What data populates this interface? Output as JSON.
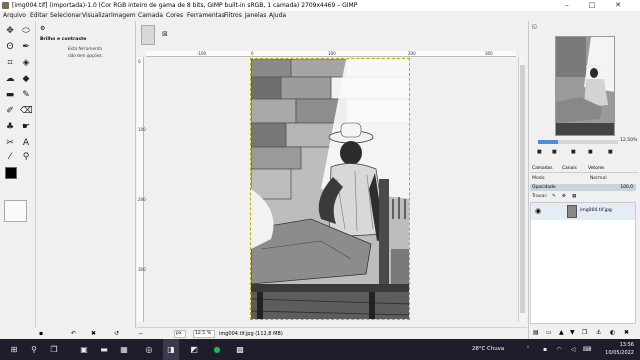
{
  "window": {
    "title": "[img004.tif] (importada)-1.0 (Cor RGB inteiro de gama de 8 bits, GIMP built-in sRGB, 1 camada) 2709x4469 – GIMP"
  },
  "menu": [
    "Arquivo",
    "Editar",
    "Selecionar",
    "Visualizar",
    "Imagem",
    "Camada",
    "Cores",
    "Ferramentas",
    "Filtros",
    "Janelas",
    "Ajuda"
  ],
  "tool_options": {
    "title": "Brilho e contraste",
    "message_line1": "Esta ferramenta",
    "message_line2": "não tem opções."
  },
  "rulers": {
    "h_labels": [
      "-100",
      "0",
      "100",
      "200",
      "300"
    ],
    "v_labels": [
      "0",
      "100",
      "200",
      "300"
    ]
  },
  "status": {
    "unit": "px",
    "zoom": "12,5 %",
    "info": "img004.tif.jpg (112,8 MB)"
  },
  "navigation": {
    "zoom_value": "12,50%",
    "zoom_fraction": 0.25
  },
  "layers": {
    "tabs": [
      "Camadas",
      "Canais",
      "Vetores"
    ],
    "mode_label": "Modo",
    "mode_value": "Normal",
    "opacity_label": "Opacidade",
    "opacity_value": "100,0",
    "lock_label": "Travar:",
    "layer_name": "img004.tif.jpg"
  },
  "taskbar": {
    "weather": "28°C  Chuva",
    "time": "13:56",
    "date": "10/05/2022"
  },
  "colors": {
    "accent": "#4a90d9",
    "taskbar": "#1d1d2b",
    "selection_border": "#b3b000"
  }
}
